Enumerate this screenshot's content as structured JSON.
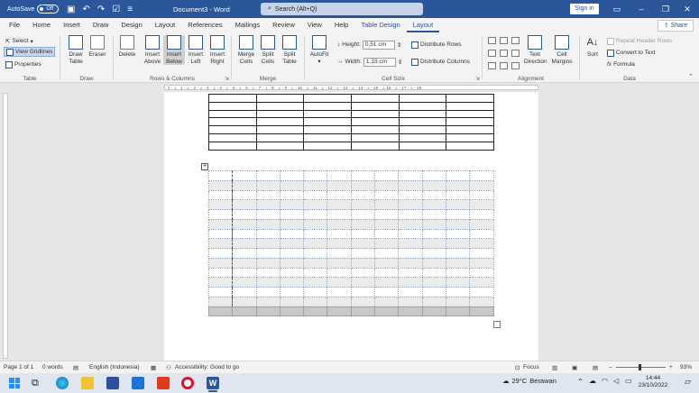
{
  "titlebar": {
    "autosave_label": "AutoSave",
    "autosave_state": "Off",
    "title": "Document3 - Word",
    "search_placeholder": "Search (Alt+Q)",
    "signin_label": "Sign in"
  },
  "tabs": [
    "File",
    "Home",
    "Insert",
    "Draw",
    "Design",
    "Layout",
    "References",
    "Mailings",
    "Review",
    "View",
    "Help",
    "Table Design",
    "Layout"
  ],
  "active_tab_index": 12,
  "share_label": "Share",
  "ribbon": {
    "table": {
      "select": "Select",
      "view_gridlines": "View Gridlines",
      "properties": "Properties",
      "label": "Table"
    },
    "draw": {
      "draw_table": "Draw Table",
      "eraser": "Eraser",
      "label": "Draw"
    },
    "rows_cols": {
      "delete": "Delete",
      "insert_above": "Insert Above",
      "insert_below": "Insert Below",
      "insert_left": "Insert Left",
      "insert_right": "Insert Right",
      "label": "Rows & Columns"
    },
    "merge": {
      "merge_cells": "Merge Cells",
      "split_cells": "Split Cells",
      "split_table": "Split Table",
      "label": "Merge"
    },
    "cell_size": {
      "autofit": "AutoFit",
      "height_label": "Height:",
      "height_value": "0,51 cm",
      "width_label": "Width:",
      "width_value": "1,33 cm",
      "distribute_rows": "Distribute Rows",
      "distribute_columns": "Distribute Columns",
      "label": "Cell Size"
    },
    "alignment": {
      "text_direction": "Text Direction",
      "cell_margins": "Cell Margins",
      "label": "Alignment"
    },
    "data": {
      "sort": "Sort",
      "repeat_header": "Repeat Header Rows",
      "convert": "Convert to Text",
      "formula": "Formula",
      "label": "Data"
    }
  },
  "ruler_text": "· 1 · ⊥ · 1 · ⊥ · 2 · ⊥ · 3 · ⊥ · 4 · ⊥ · 5 · ⊥ · 6 · ⊥ · 7 · ⊥ · 8 · ⊥ · 9 · ⊥ · 10 · ⊥ · 11 · ⊥ · 12 · ⊥ · 13 · ⊥ · 14 · ⊥ · 15 · ⊥ 16 · ⊥ · 17 · ⊥ · 18",
  "status": {
    "page": "Page 1 of 1",
    "words": "0 words",
    "language": "English (Indonesia)",
    "accessibility": "Accessibility: Good to go",
    "focus": "Focus",
    "zoom": "93%"
  },
  "taskbar": {
    "weather_temp": "29°C",
    "weather_desc": "Berawan",
    "time": "14:44",
    "date": "23/10/2022"
  },
  "colors": {
    "accent": "#2b579a",
    "titlebar": "#2b579a"
  }
}
